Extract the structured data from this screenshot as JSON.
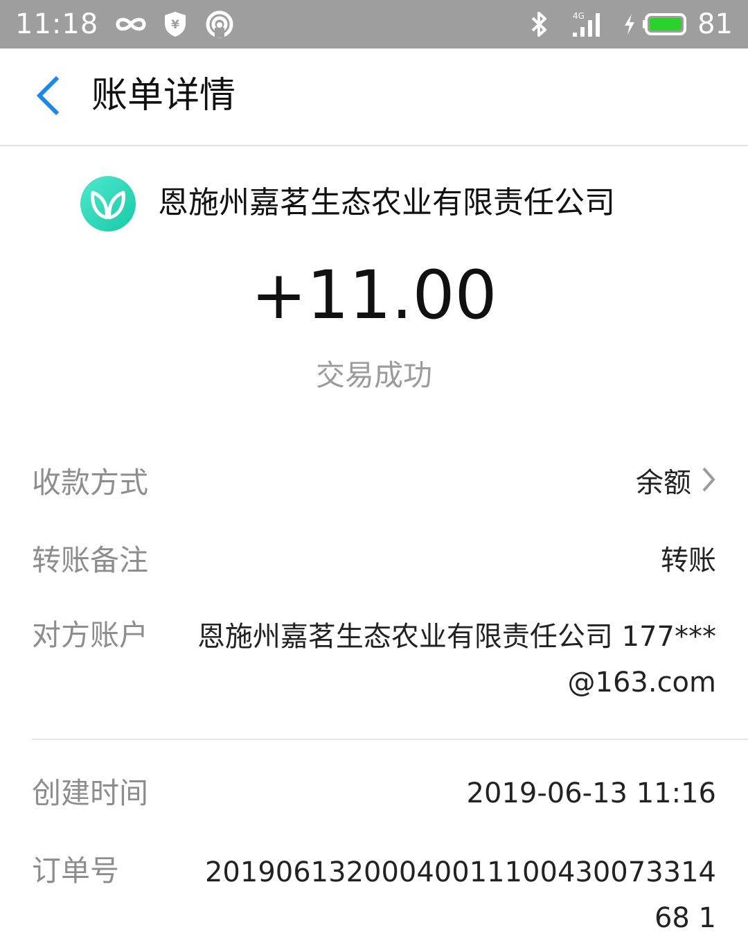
{
  "status_bar": {
    "time": "11:18",
    "battery_level": "81",
    "battery_fraction": 0.81,
    "network": "4G",
    "battery_color": "#2bd22b"
  },
  "header": {
    "title": "账单详情",
    "back_icon": "chevron-left-icon",
    "accent_color": "#1e88e5"
  },
  "merchant": {
    "name": "恩施州嘉茗生态农业有限责任公司",
    "logo_icon": "leaf-icon"
  },
  "transaction": {
    "amount": "+11.00",
    "status": "交易成功"
  },
  "details": {
    "payment_method": {
      "label": "收款方式",
      "value": "余额"
    },
    "remark": {
      "label": "转账备注",
      "value": "转账"
    },
    "counterparty": {
      "label": "对方账户",
      "value": "恩施州嘉茗生态农业有限责任公司 177***@163.com"
    },
    "created_time": {
      "label": "创建时间",
      "value": "2019-06-13 11:16"
    },
    "order_number": {
      "label": "订单号",
      "value": "2019061320004001110043007331468 1"
    }
  }
}
